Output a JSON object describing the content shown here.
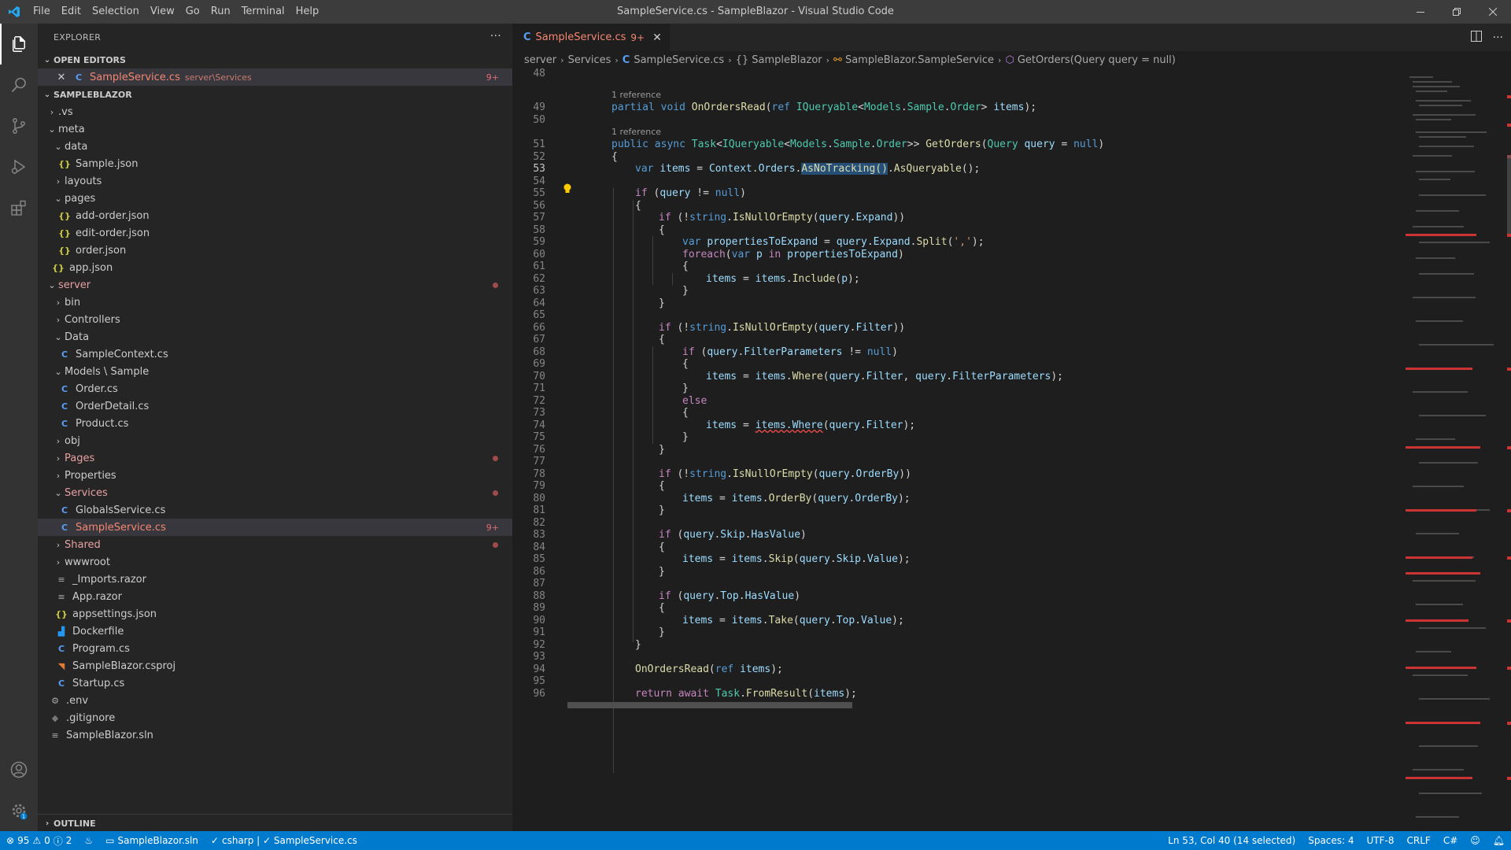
{
  "window": {
    "title": "SampleService.cs - SampleBlazor - Visual Studio Code"
  },
  "menu": [
    "File",
    "Edit",
    "Selection",
    "View",
    "Go",
    "Run",
    "Terminal",
    "Help"
  ],
  "sidebar": {
    "title": "EXPLORER",
    "open_editors": {
      "header": "OPEN EDITORS",
      "items": [
        {
          "name": "SampleService.cs",
          "path": "server\\Services",
          "badge": "9+"
        }
      ]
    },
    "project": {
      "header": "SAMPLEBLAZOR",
      "tree": [
        {
          "label": ".vs"
        },
        {
          "label": "meta"
        },
        {
          "label": "data"
        },
        {
          "label": "Sample.json"
        },
        {
          "label": "layouts"
        },
        {
          "label": "pages"
        },
        {
          "label": "add-order.json"
        },
        {
          "label": "edit-order.json"
        },
        {
          "label": "order.json"
        },
        {
          "label": "app.json"
        },
        {
          "label": "server"
        },
        {
          "label": "bin"
        },
        {
          "label": "Controllers"
        },
        {
          "label": "Data"
        },
        {
          "label": "SampleContext.cs"
        },
        {
          "label": "Models \\ Sample"
        },
        {
          "label": "Order.cs"
        },
        {
          "label": "OrderDetail.cs"
        },
        {
          "label": "Product.cs"
        },
        {
          "label": "obj"
        },
        {
          "label": "Pages"
        },
        {
          "label": "Properties"
        },
        {
          "label": "Services"
        },
        {
          "label": "GlobalsService.cs"
        },
        {
          "label": "SampleService.cs",
          "badge": "9+"
        },
        {
          "label": "Shared"
        },
        {
          "label": "wwwroot"
        },
        {
          "label": "_Imports.razor"
        },
        {
          "label": "App.razor"
        },
        {
          "label": "appsettings.json"
        },
        {
          "label": "Dockerfile"
        },
        {
          "label": "Program.cs"
        },
        {
          "label": "SampleBlazor.csproj"
        },
        {
          "label": "Startup.cs"
        },
        {
          "label": ".env"
        },
        {
          "label": ".gitignore"
        },
        {
          "label": "SampleBlazor.sln"
        }
      ]
    },
    "outline": "OUTLINE"
  },
  "tab": {
    "label": "SampleService.cs",
    "badge": "9+"
  },
  "breadcrumbs": [
    "server",
    "Services",
    "SampleService.cs",
    "{} SampleBlazor",
    "SampleBlazor.SampleService",
    "GetOrders(Query query = null)"
  ],
  "code": {
    "reference": "1 reference",
    "line_numbers": [
      "48",
      "49",
      "50",
      "51",
      "52",
      "53",
      "54",
      "55",
      "56",
      "57",
      "58",
      "59",
      "60",
      "61",
      "62",
      "63",
      "64",
      "65",
      "66",
      "67",
      "68",
      "69",
      "70",
      "71",
      "72",
      "73",
      "74",
      "75",
      "76",
      "77",
      "78",
      "79",
      "80",
      "81",
      "82",
      "83",
      "84",
      "85",
      "86",
      "87",
      "88",
      "89",
      "90",
      "91",
      "92",
      "93",
      "94",
      "95",
      "96"
    ],
    "lines": {
      "l49": [
        "partial",
        " ",
        "void",
        " ",
        "OnOrdersRead",
        "(",
        "ref",
        " ",
        "IQueryable",
        "<",
        "Models",
        ".",
        "Sample",
        ".",
        "Order",
        "> ",
        "items",
        ");"
      ],
      "l51": [
        "public",
        " ",
        "async",
        " ",
        "Task",
        "<",
        "IQueryable",
        "<",
        "Models",
        ".",
        "Sample",
        ".",
        "Order",
        ">> ",
        "GetOrders",
        "(",
        "Query",
        " ",
        "query",
        " = ",
        "null",
        ")"
      ],
      "l52": "{",
      "l53": [
        "var",
        " ",
        "items",
        " = ",
        "Context",
        ".",
        "Orders",
        ".",
        "AsNoTracking()",
        ".",
        "AsQueryable",
        "();"
      ],
      "l55": [
        "if",
        " (",
        "query",
        " != ",
        "null",
        ")"
      ],
      "l56": "{",
      "l57": [
        "if",
        " (!",
        "string",
        ".",
        "IsNullOrEmpty",
        "(",
        "query",
        ".",
        "Expand",
        "))"
      ],
      "l58": "{",
      "l59": [
        "var",
        " ",
        "propertiesToExpand",
        " = ",
        "query",
        ".",
        "Expand",
        ".",
        "Split",
        "(",
        "','",
        ");"
      ],
      "l60": [
        "foreach",
        "(",
        "var",
        " ",
        "p",
        " ",
        "in",
        " ",
        "propertiesToExpand",
        ")"
      ],
      "l61": "{",
      "l62": [
        "items",
        " = ",
        "items",
        ".",
        "Include",
        "(",
        "p",
        ");"
      ],
      "l63": "}",
      "l64": "}",
      "l66": [
        "if",
        " (!",
        "string",
        ".",
        "IsNullOrEmpty",
        "(",
        "query",
        ".",
        "Filter",
        "))"
      ],
      "l67": "{",
      "l68": [
        "if",
        " (",
        "query",
        ".",
        "FilterParameters",
        " != ",
        "null",
        ")"
      ],
      "l69": "{",
      "l70": [
        "items",
        " = ",
        "items",
        ".",
        "Where",
        "(",
        "query",
        ".",
        "Filter",
        ", ",
        "query",
        ".",
        "FilterParameters",
        ");"
      ],
      "l71": "}",
      "l72": "else",
      "l73": "{",
      "l74": [
        "items",
        " = ",
        "items.Where",
        "(",
        "query",
        ".",
        "Filter",
        ");"
      ],
      "l75": "}",
      "l76": "}",
      "l78": [
        "if",
        " (!",
        "string",
        ".",
        "IsNullOrEmpty",
        "(",
        "query",
        ".",
        "OrderBy",
        "))"
      ],
      "l79": "{",
      "l80": [
        "items",
        " = ",
        "items",
        ".",
        "OrderBy",
        "(",
        "query",
        ".",
        "OrderBy",
        ");"
      ],
      "l81": "}",
      "l83": [
        "if",
        " (",
        "query",
        ".",
        "Skip",
        ".",
        "HasValue",
        ")"
      ],
      "l84": "{",
      "l85": [
        "items",
        " = ",
        "items",
        ".",
        "Skip",
        "(",
        "query",
        ".",
        "Skip",
        ".",
        "Value",
        ");"
      ],
      "l86": "}",
      "l88": [
        "if",
        " (",
        "query",
        ".",
        "Top",
        ".",
        "HasValue",
        ")"
      ],
      "l89": "{",
      "l90": [
        "items",
        " = ",
        "items",
        ".",
        "Take",
        "(",
        "query",
        ".",
        "Top",
        ".",
        "Value",
        ");"
      ],
      "l91": "}",
      "l92": "}",
      "l94": [
        "OnOrdersRead",
        "(",
        "ref",
        " ",
        "items",
        ");"
      ],
      "l96": [
        "return",
        " ",
        "await",
        " ",
        "Task",
        ".",
        "FromResult",
        "(",
        "items",
        ");"
      ]
    }
  },
  "status": {
    "errors": "95",
    "warnings": "0",
    "infos": "2",
    "solution": "SampleBlazor.sln",
    "project": "csharp | ✓ SampleService.cs",
    "position": "Ln 53, Col 40 (14 selected)",
    "spaces": "Spaces: 4",
    "encoding": "UTF-8",
    "eol": "CRLF",
    "language": "C#"
  },
  "colors": {
    "accent": "#007acc",
    "error": "#f48771",
    "titlebar": "#3c3c3c",
    "sidebar": "#252526",
    "editor": "#1e1e1e"
  }
}
